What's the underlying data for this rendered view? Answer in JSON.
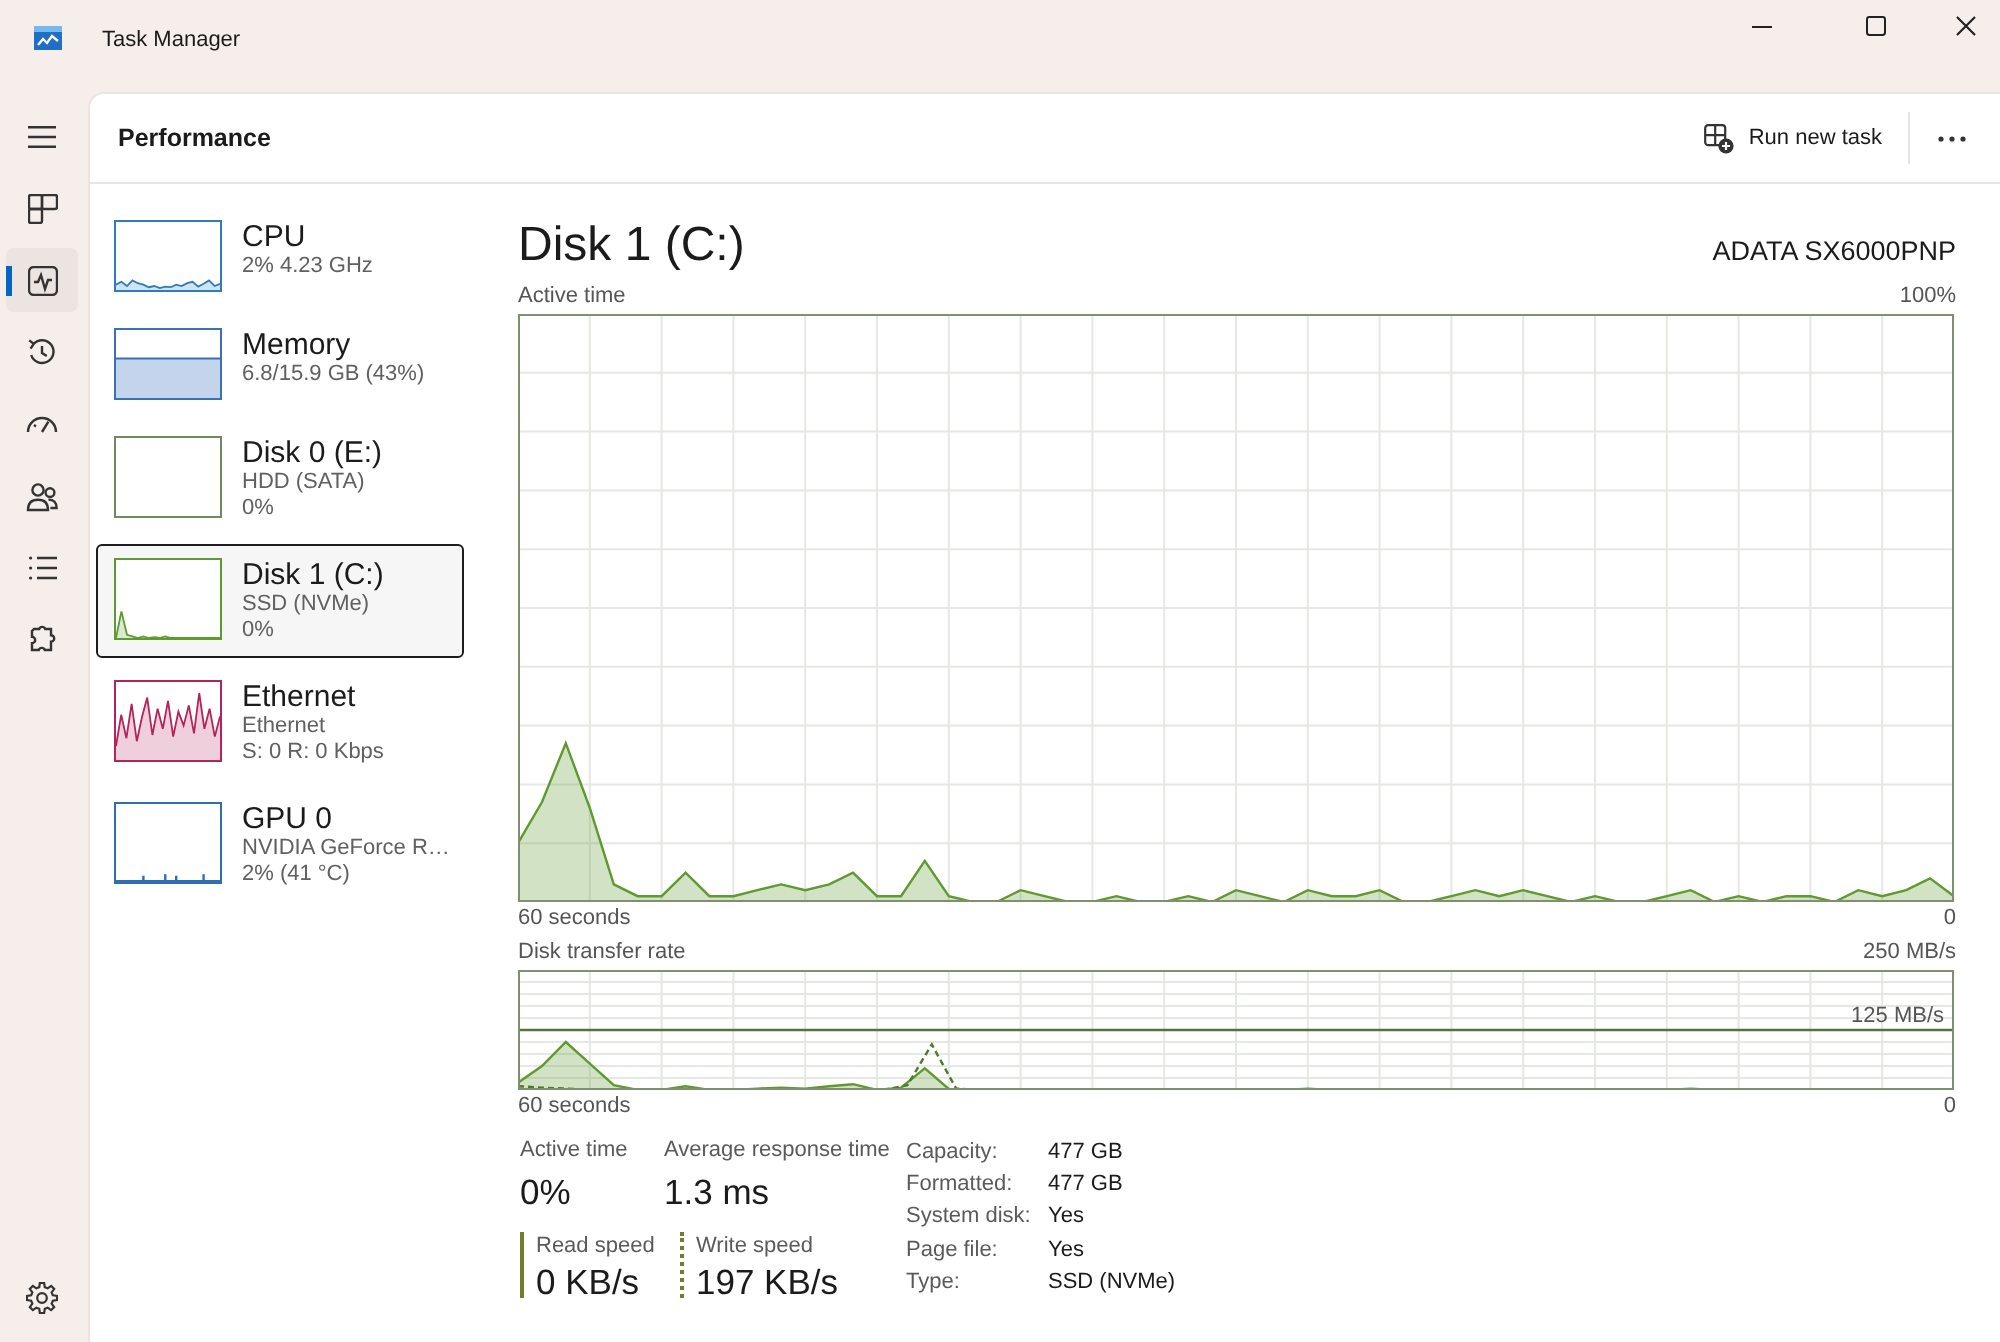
{
  "window": {
    "title": "Task Manager"
  },
  "nav_rail": {
    "pages": [
      {
        "selected": false
      },
      {
        "selected": true
      },
      {
        "selected": false
      },
      {
        "selected": false
      },
      {
        "selected": false
      },
      {
        "selected": false
      },
      {
        "selected": false
      }
    ]
  },
  "header": {
    "title": "Performance",
    "action": "Run new task"
  },
  "resources": [
    {
      "name": "CPU",
      "details": [
        "2% 4.23 GHz"
      ],
      "color": "#2e7bbf",
      "selected": false
    },
    {
      "name": "Memory",
      "details": [
        "6.8/15.9 GB (43%)"
      ],
      "color": "#3a6fba",
      "selected": false
    },
    {
      "name": "Disk 0 (E:)",
      "details": [
        "HDD (SATA)",
        "0%"
      ],
      "color": "#6f8a5c",
      "selected": false
    },
    {
      "name": "Disk 1 (C:)",
      "details": [
        "SSD (NVMe)",
        "0%"
      ],
      "color": "#5f9a2e",
      "selected": true
    },
    {
      "name": "Ethernet",
      "details": [
        "Ethernet",
        "S: 0 R: 0 Kbps"
      ],
      "color": "#b4235a",
      "selected": false
    },
    {
      "name": "GPU 0",
      "details": [
        "NVIDIA GeForce R…",
        "2% (41 °C)"
      ],
      "color": "#2f6db5",
      "selected": false
    }
  ],
  "detail": {
    "title": "Disk 1 (C:)",
    "model": "ADATA SX6000PNP",
    "graphs": [
      {
        "title": "Active time",
        "scale_labels": [
          "100%",
          "0"
        ],
        "span_label": "60 seconds"
      },
      {
        "title": "Disk transfer rate",
        "scale_labels": [
          "250 MB/s",
          "125 MB/s",
          "0"
        ],
        "span_label": "60 seconds"
      }
    ],
    "stats": [
      {
        "label": "Active time",
        "value": "0%"
      },
      {
        "label": "Average response time",
        "value": "1.3 ms"
      }
    ],
    "speeds": [
      {
        "label": "Read speed",
        "value": "0 KB/s",
        "kind": "solid"
      },
      {
        "label": "Write speed",
        "value": "197 KB/s",
        "kind": "dotted"
      }
    ],
    "properties": [
      {
        "label": "Capacity:",
        "value": "477 GB"
      },
      {
        "label": "Formatted:",
        "value": "477 GB"
      },
      {
        "label": "System disk:",
        "value": "Yes"
      },
      {
        "label": "Page file:",
        "value": "Yes"
      },
      {
        "label": "Type:",
        "value": "SSD (NVMe)"
      }
    ]
  }
}
